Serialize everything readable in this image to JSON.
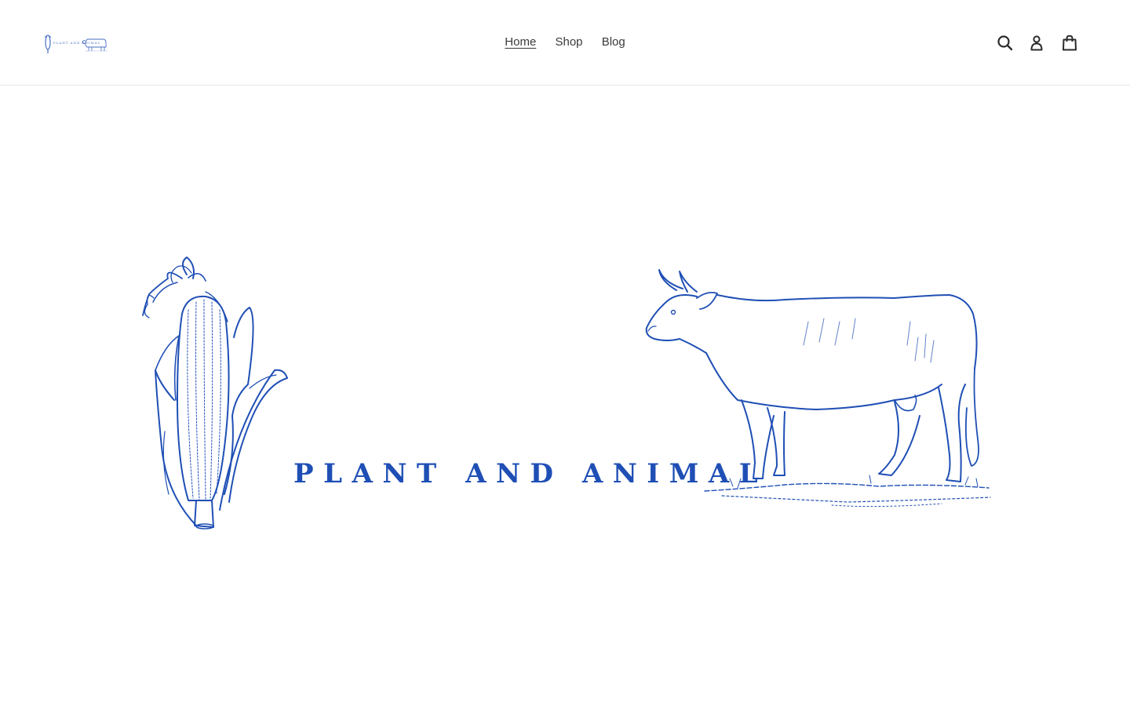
{
  "header": {
    "logo": {
      "alt_text": "PLANT AND ANIMAL",
      "icon": "corn-cow-logo"
    },
    "nav": [
      {
        "label": "Home",
        "active": true
      },
      {
        "label": "Shop",
        "active": false
      },
      {
        "label": "Blog",
        "active": false
      }
    ],
    "icons": {
      "search": "search-icon",
      "account": "account-icon",
      "cart": "cart-icon"
    }
  },
  "hero": {
    "title": "PLANT AND ANIMAL",
    "illustrations": [
      "corn-illustration",
      "cow-illustration"
    ],
    "accent_color": "#1f4fb5"
  },
  "colors": {
    "text": "#3a3a3a",
    "border": "#e8e8e8",
    "brand_blue": "#1f4fb5"
  }
}
